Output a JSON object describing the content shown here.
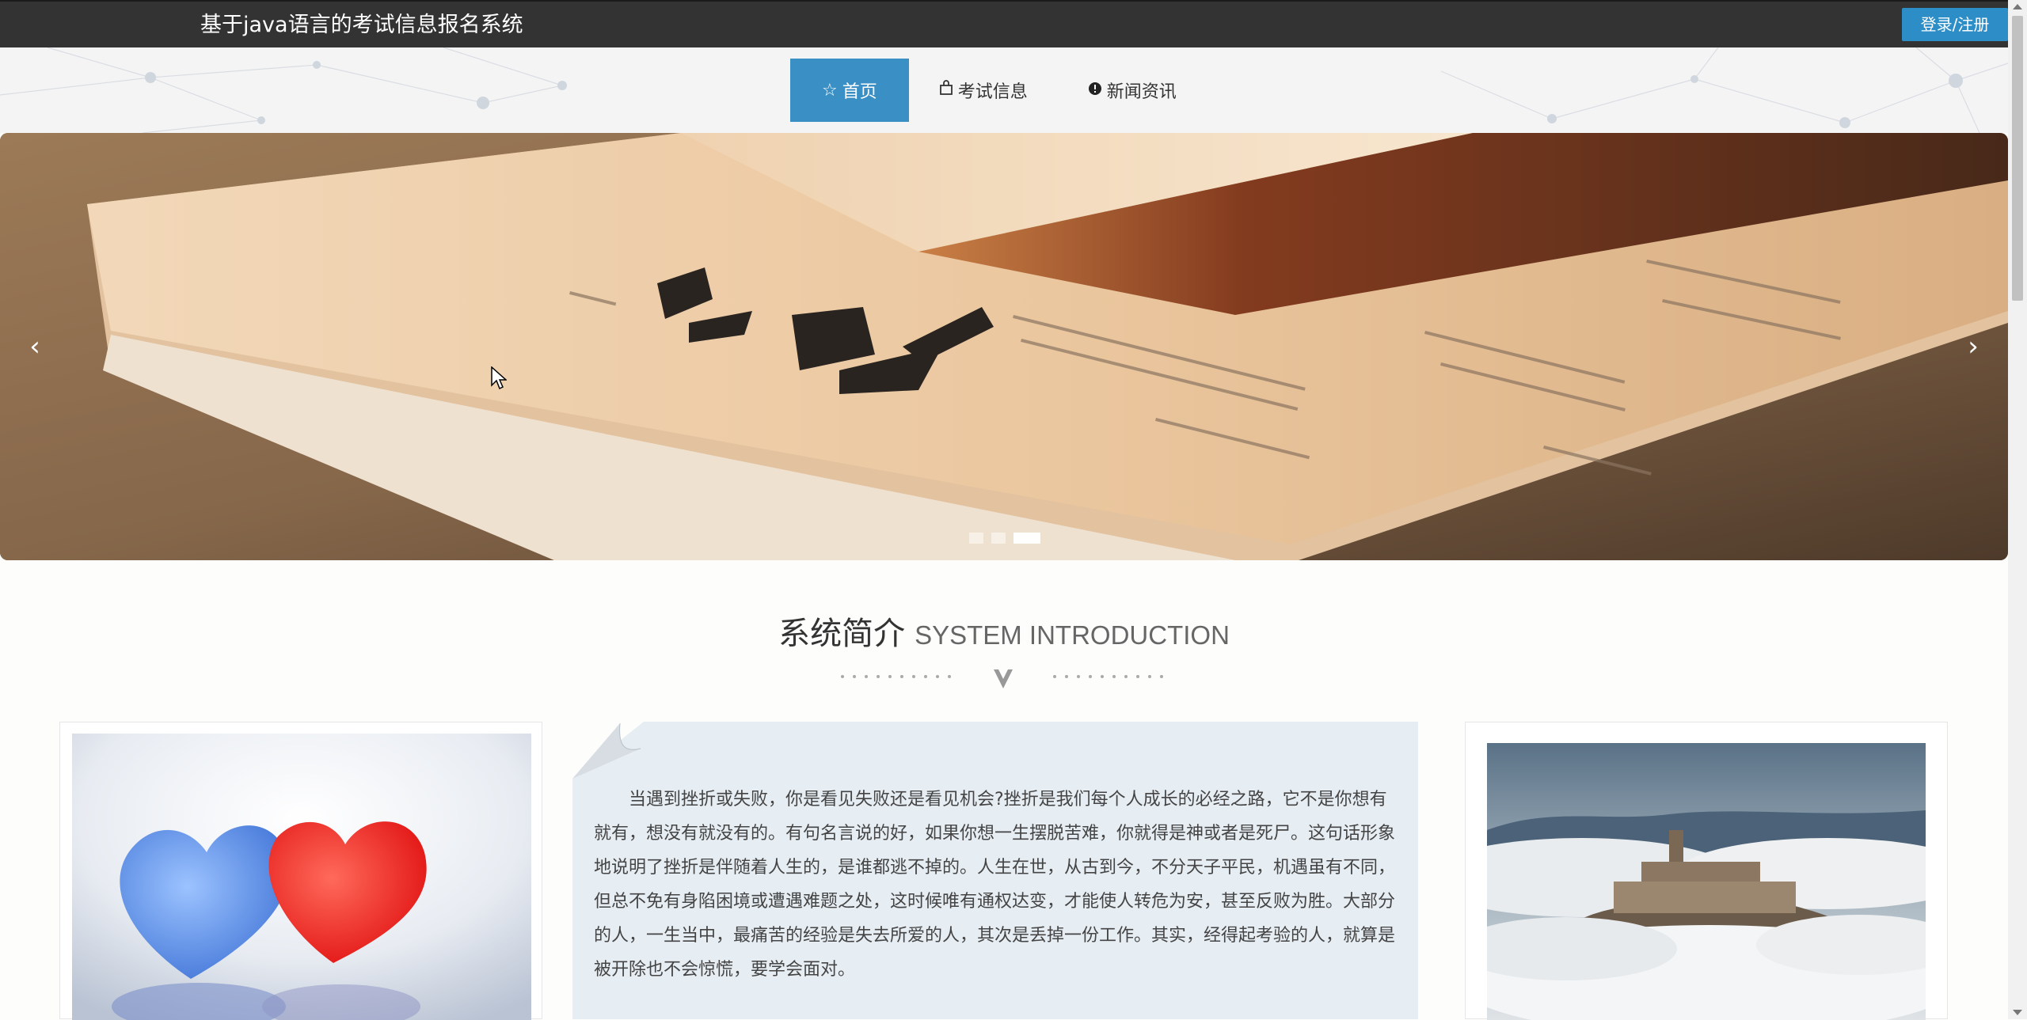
{
  "header": {
    "site_title": "基于java语言的考试信息报名系统",
    "login_label": "登录/注册"
  },
  "nav": {
    "items": [
      {
        "label": "首页",
        "icon": "star-icon",
        "active": true
      },
      {
        "label": "考试信息",
        "icon": "bag-icon",
        "active": false
      },
      {
        "label": "新闻资讯",
        "icon": "exclamation-circle-icon",
        "active": false
      }
    ]
  },
  "carousel": {
    "prev_label": "‹",
    "next_label": "›",
    "slide_count": 3,
    "active_slide": 3
  },
  "intro": {
    "title_cn": "系统简介",
    "title_en": "SYSTEM INTRODUCTION",
    "text": "当遇到挫折或失败，你是看见失败还是看见机会?挫折是我们每个人成长的必经之路，它不是你想有就有，想没有就没有的。有句名言说的好，如果你想一生摆脱苦难，你就得是神或者是死尸。这句话形象地说明了挫折是伴随着人生的，是谁都逃不掉的。人生在世，从古到今，不分天子平民，机遇虽有不同，但总不免有身陷困境或遭遇难题之处，这时候唯有通权达变，才能使人转危为安，甚至反败为胜。大部分的人，一生当中，最痛苦的经验是失去所爱的人，其次是丢掉一份工作。其实，经得起考验的人，就算是被开除也不会惊慌，要学会面对。"
  },
  "colors": {
    "topbar": "#333333",
    "accent": "#3a8fc4",
    "login": "#2d8dc7"
  }
}
